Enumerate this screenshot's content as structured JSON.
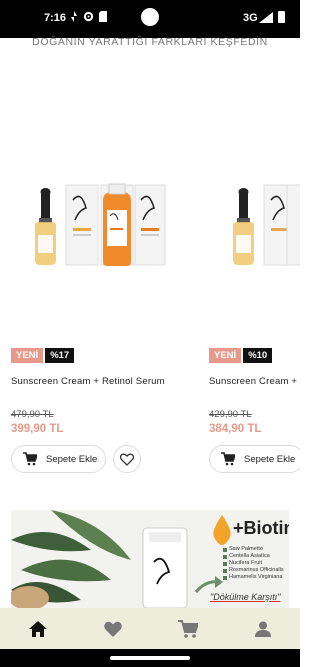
{
  "status_bar": {
    "time": "7:16",
    "network": "3G"
  },
  "header": {
    "tagline": "DOĞANIN YARATTIĞI FARKLARI KEŞFEDİN"
  },
  "products": [
    {
      "badge_new": "YENİ",
      "badge_discount": "%17",
      "name": "Sunscreen Cream + Retinol Serum",
      "old_price": "479,90 TL",
      "price": "399,90 TL",
      "add_to_cart": "Sepete Ekle"
    },
    {
      "badge_new": "YENİ",
      "badge_discount": "%10",
      "name": "Sunscreen Cream + C",
      "old_price": "429,90 TL",
      "price": "384,90 TL",
      "add_to_cart": "Sepete Ekle"
    }
  ],
  "banner": {
    "headline": "+Biotin",
    "ingredients": [
      "Saw Palmetto",
      "Centella Asiatica",
      "Nucifera Fruit",
      "Rosmarinus Officinalis",
      "Hamamelis Virginiana"
    ],
    "slogan": "\"Dökülme Karşıtı\""
  },
  "colors": {
    "accent": "#e8998a",
    "nav_bg": "#ededdc",
    "discount_bg": "#111111"
  },
  "bottom_nav": {
    "items": [
      "home-icon",
      "heart-icon",
      "cart-icon",
      "user-icon"
    ],
    "active": "home-icon"
  }
}
